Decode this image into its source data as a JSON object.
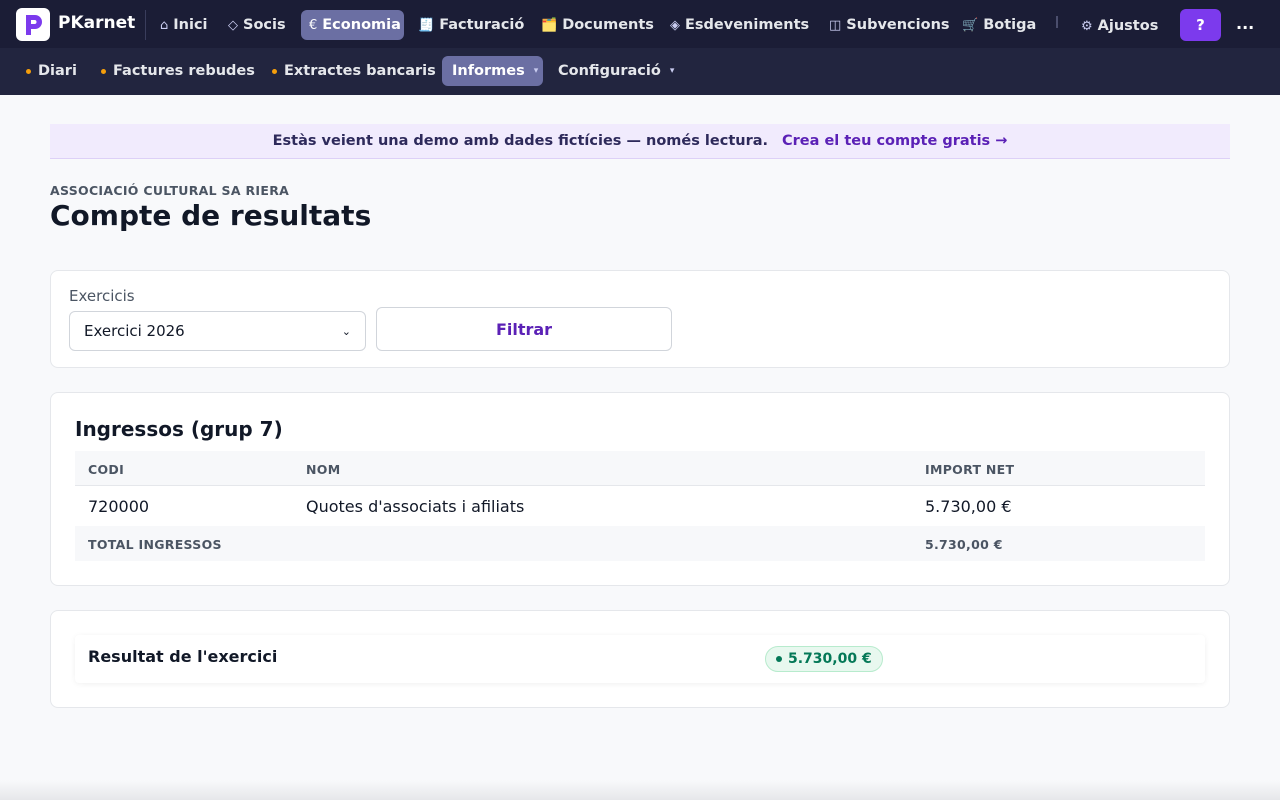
{
  "app": {
    "brand": "PKarnet",
    "logo_letter": "P",
    "colors": {
      "nav_bg": "#1b1d36",
      "subnav_bg": "#22253f",
      "accent": "#7c3aed",
      "active_tab": "#6b6fa3",
      "success": "#047857"
    }
  },
  "nav": {
    "items": [
      {
        "icon": "home-icon",
        "glyph": "⌂",
        "label": "Inici"
      },
      {
        "icon": "diamond-icon",
        "glyph": "◇",
        "label": "Socis"
      },
      {
        "icon": "euro-icon",
        "glyph": "€",
        "label": "Economia"
      },
      {
        "icon": "receipt-icon",
        "glyph": "🧾",
        "label": "Facturació"
      },
      {
        "icon": "folder-icon",
        "glyph": "🗂️",
        "label": "Documents"
      },
      {
        "icon": "event-icon",
        "glyph": "◈",
        "label": "Esdeveniments"
      },
      {
        "icon": "columns-icon",
        "glyph": "◫",
        "label": "Subvencions"
      },
      {
        "icon": "cart-icon",
        "glyph": "🛒",
        "label": "Botiga"
      }
    ],
    "settings": {
      "icon": "gear-icon",
      "glyph": "⚙",
      "label": "Ajustos"
    },
    "help_label": "?",
    "more_label": "..."
  },
  "subnav": {
    "items": [
      {
        "label": "Diari"
      },
      {
        "label": "Factures rebudes"
      },
      {
        "label": "Extractes bancaris"
      },
      {
        "label": "Informes"
      },
      {
        "label": "Configuració"
      }
    ],
    "caret": "▾"
  },
  "banner": {
    "text": "Estàs veient una demo amb dades fictícies — només lectura.",
    "link": "Crea el teu compte gratis →"
  },
  "page": {
    "org": "ASSOCIACIÓ CULTURAL SA RIERA",
    "title": "Compte de resultats"
  },
  "filter": {
    "label": "Exercicis",
    "selected": "Exercici 2026",
    "button": "Filtrar"
  },
  "income": {
    "title": "Ingressos (grup 7)",
    "headers": [
      "CODI",
      "NOM",
      "IMPORT NET"
    ],
    "rows": [
      {
        "code": "720000",
        "name": "Quotes d'associats i afiliats",
        "amount": "5.730,00 €"
      }
    ],
    "total_label": "TOTAL INGRESSOS",
    "total_amount": "5.730,00 €"
  },
  "result": {
    "label": "Resultat de l'exercici",
    "amount": "5.730,00 €"
  }
}
